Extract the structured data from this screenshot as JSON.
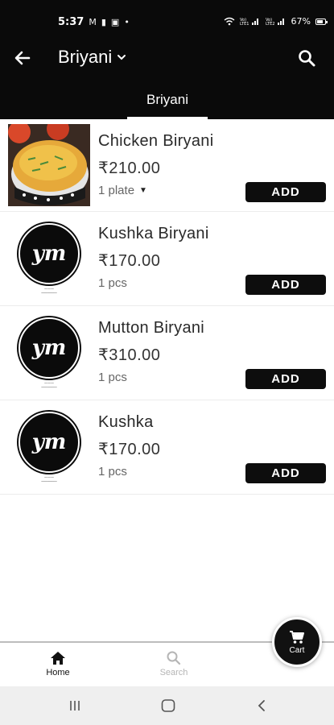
{
  "status_bar": {
    "time": "5:37",
    "left_icons": [
      "gmail-icon",
      "message-icon",
      "instagram-icon",
      "dot-icon"
    ],
    "right_icons": [
      "wifi-icon",
      "volte-signal-icon",
      "volte-signal-icon-2"
    ],
    "battery": "67%"
  },
  "app_bar": {
    "title": "Briyani",
    "back_icon": "arrow-left-icon",
    "dropdown_icon": "chevron-down-icon",
    "search_icon": "search-icon"
  },
  "tabs": [
    {
      "label": "Briyani",
      "selected": true
    }
  ],
  "items": [
    {
      "name": "Chicken Biryani",
      "price": "₹210.00",
      "unit": "1 plate",
      "has_unit_dropdown": true,
      "image": "biryani-photo",
      "add_label": "ADD"
    },
    {
      "name": "Kushka Biryani",
      "price": "₹170.00",
      "unit": "1 pcs",
      "has_unit_dropdown": false,
      "image": "restaurant-logo",
      "add_label": "ADD"
    },
    {
      "name": "Mutton Biryani",
      "price": "₹310.00",
      "unit": "1 pcs",
      "has_unit_dropdown": false,
      "image": "restaurant-logo",
      "add_label": "ADD"
    },
    {
      "name": "Kushka",
      "price": "₹170.00",
      "unit": "1 pcs",
      "has_unit_dropdown": false,
      "image": "restaurant-logo",
      "add_label": "ADD"
    }
  ],
  "bottom_nav": {
    "home_label": "Home",
    "search_label": "Search",
    "cart_label": "Cart"
  },
  "colors": {
    "header_bg": "#0a0a0a",
    "button_bg": "#0d0d0d",
    "inactive_nav": "#b5b5b5",
    "system_nav_bg": "#efefef"
  }
}
